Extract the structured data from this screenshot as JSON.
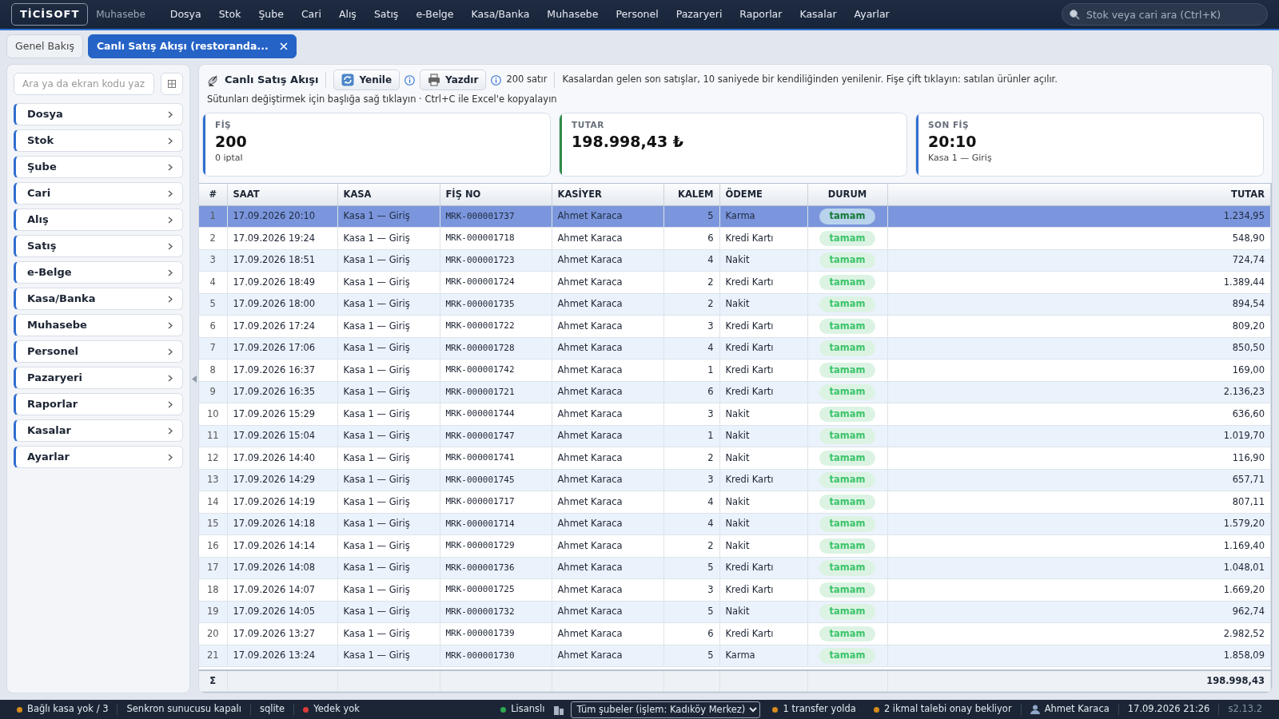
{
  "app": {
    "logo": "TİCİSOFT",
    "module": "Muhasebe"
  },
  "menu": [
    "Dosya",
    "Stok",
    "Şube",
    "Cari",
    "Alış",
    "Satış",
    "e-Belge",
    "Kasa/Banka",
    "Muhasebe",
    "Personel",
    "Pazaryeri",
    "Raporlar",
    "Kasalar",
    "Ayarlar"
  ],
  "global_search": {
    "placeholder": "Stok veya cari ara (Ctrl+K)"
  },
  "tabs": [
    {
      "label": "Genel Bakış",
      "selected": false,
      "closable": false
    },
    {
      "label": "Canlı Satış Akışı (restoranda...",
      "selected": true,
      "closable": true
    }
  ],
  "sidebar": {
    "search": {
      "placeholder": "Ara ya da ekran kodu yaz"
    },
    "items": [
      "Dosya",
      "Stok",
      "Şube",
      "Cari",
      "Alış",
      "Satış",
      "e-Belge",
      "Kasa/Banka",
      "Muhasebe",
      "Personel",
      "Pazaryeri",
      "Raporlar",
      "Kasalar",
      "Ayarlar"
    ]
  },
  "toolbar": {
    "title": "Canlı Satış Akışı",
    "refresh": "Yenile",
    "print": "Yazdır",
    "row_count": "200 satır",
    "description": "Kasalardan gelen son satışlar, 10 saniyede bir kendiliğinden yenilenir. Fişe çift tıklayın: satılan ürünler açılır.",
    "hint": "Sütunları değiştirmek için başlığa sağ tıklayın · Ctrl+C ile Excel'e kopyalayın"
  },
  "kpis": [
    {
      "label": "FİŞ",
      "value": "200",
      "sub": "0 iptal",
      "color": "#2f6fd0"
    },
    {
      "label": "TUTAR",
      "value": "198.998,43 ₺",
      "color": "#2e8b4a"
    },
    {
      "label": "SON FİŞ",
      "value": "20:10",
      "sub": "Kasa 1 — Giriş",
      "color": "#2f6fd0"
    }
  ],
  "table": {
    "columns": [
      "#",
      "SAAT",
      "KASA",
      "FİŞ NO",
      "KASİYER",
      "KALEM",
      "ÖDEME",
      "DURUM",
      "TUTAR"
    ],
    "rows": [
      {
        "cells": [
          "1",
          "17.09.2026 20:10",
          "Kasa 1 — Giriş",
          "MRK-000001737",
          "Ahmet Karaca",
          "5",
          "Karma",
          "tamam",
          "1.234,95"
        ],
        "selected": true
      },
      {
        "cells": [
          "2",
          "17.09.2026 19:24",
          "Kasa 1 — Giriş",
          "MRK-000001718",
          "Ahmet Karaca",
          "6",
          "Kredi Kartı",
          "tamam",
          "548,90"
        ],
        "selected": false
      },
      {
        "cells": [
          "3",
          "17.09.2026 18:51",
          "Kasa 1 — Giriş",
          "MRK-000001723",
          "Ahmet Karaca",
          "4",
          "Nakit",
          "tamam",
          "724,74"
        ],
        "selected": false
      },
      {
        "cells": [
          "4",
          "17.09.2026 18:49",
          "Kasa 1 — Giriş",
          "MRK-000001724",
          "Ahmet Karaca",
          "2",
          "Kredi Kartı",
          "tamam",
          "1.389,44"
        ],
        "selected": false
      },
      {
        "cells": [
          "5",
          "17.09.2026 18:00",
          "Kasa 1 — Giriş",
          "MRK-000001735",
          "Ahmet Karaca",
          "2",
          "Nakit",
          "tamam",
          "894,54"
        ],
        "selected": false
      },
      {
        "cells": [
          "6",
          "17.09.2026 17:24",
          "Kasa 1 — Giriş",
          "MRK-000001722",
          "Ahmet Karaca",
          "3",
          "Kredi Kartı",
          "tamam",
          "809,20"
        ],
        "selected": false
      },
      {
        "cells": [
          "7",
          "17.09.2026 17:06",
          "Kasa 1 — Giriş",
          "MRK-000001728",
          "Ahmet Karaca",
          "4",
          "Kredi Kartı",
          "tamam",
          "850,50"
        ],
        "selected": false
      },
      {
        "cells": [
          "8",
          "17.09.2026 16:37",
          "Kasa 1 — Giriş",
          "MRK-000001742",
          "Ahmet Karaca",
          "1",
          "Kredi Kartı",
          "tamam",
          "169,00"
        ],
        "selected": false
      },
      {
        "cells": [
          "9",
          "17.09.2026 16:35",
          "Kasa 1 — Giriş",
          "MRK-000001721",
          "Ahmet Karaca",
          "6",
          "Kredi Kartı",
          "tamam",
          "2.136,23"
        ],
        "selected": false
      },
      {
        "cells": [
          "10",
          "17.09.2026 15:29",
          "Kasa 1 — Giriş",
          "MRK-000001744",
          "Ahmet Karaca",
          "3",
          "Nakit",
          "tamam",
          "636,60"
        ],
        "selected": false
      },
      {
        "cells": [
          "11",
          "17.09.2026 15:04",
          "Kasa 1 — Giriş",
          "MRK-000001747",
          "Ahmet Karaca",
          "1",
          "Nakit",
          "tamam",
          "1.019,70"
        ],
        "selected": false
      },
      {
        "cells": [
          "12",
          "17.09.2026 14:40",
          "Kasa 1 — Giriş",
          "MRK-000001741",
          "Ahmet Karaca",
          "2",
          "Nakit",
          "tamam",
          "116,90"
        ],
        "selected": false
      },
      {
        "cells": [
          "13",
          "17.09.2026 14:29",
          "Kasa 1 — Giriş",
          "MRK-000001745",
          "Ahmet Karaca",
          "3",
          "Kredi Kartı",
          "tamam",
          "657,71"
        ],
        "selected": false
      },
      {
        "cells": [
          "14",
          "17.09.2026 14:19",
          "Kasa 1 — Giriş",
          "MRK-000001717",
          "Ahmet Karaca",
          "4",
          "Nakit",
          "tamam",
          "807,11"
        ],
        "selected": false
      },
      {
        "cells": [
          "15",
          "17.09.2026 14:18",
          "Kasa 1 — Giriş",
          "MRK-000001714",
          "Ahmet Karaca",
          "4",
          "Nakit",
          "tamam",
          "1.579,20"
        ],
        "selected": false
      },
      {
        "cells": [
          "16",
          "17.09.2026 14:14",
          "Kasa 1 — Giriş",
          "MRK-000001729",
          "Ahmet Karaca",
          "2",
          "Nakit",
          "tamam",
          "1.169,40"
        ],
        "selected": false
      },
      {
        "cells": [
          "17",
          "17.09.2026 14:08",
          "Kasa 1 — Giriş",
          "MRK-000001736",
          "Ahmet Karaca",
          "5",
          "Kredi Kartı",
          "tamam",
          "1.048,01"
        ],
        "selected": false
      },
      {
        "cells": [
          "18",
          "17.09.2026 14:07",
          "Kasa 1 — Giriş",
          "MRK-000001725",
          "Ahmet Karaca",
          "3",
          "Kredi Kartı",
          "tamam",
          "1.669,20"
        ],
        "selected": false
      },
      {
        "cells": [
          "19",
          "17.09.2026 14:05",
          "Kasa 1 — Giriş",
          "MRK-000001732",
          "Ahmet Karaca",
          "5",
          "Nakit",
          "tamam",
          "962,74"
        ],
        "selected": false
      },
      {
        "cells": [
          "20",
          "17.09.2026 13:27",
          "Kasa 1 — Giriş",
          "MRK-000001739",
          "Ahmet Karaca",
          "6",
          "Kredi Kartı",
          "tamam",
          "2.982,52"
        ],
        "selected": false
      },
      {
        "cells": [
          "21",
          "17.09.2026 13:24",
          "Kasa 1 — Giriş",
          "MRK-000001730",
          "Ahmet Karaca",
          "5",
          "Karma",
          "tamam",
          "1.858,09"
        ],
        "selected": false
      }
    ],
    "footer": {
      "sigma": "Σ",
      "total": "198.998,43"
    }
  },
  "status_bar": [
    {
      "kind": "dot",
      "text": "Bağlı kasa yok / 3",
      "color": "#d88a1c"
    },
    {
      "kind": "text",
      "text": "Senkron sunucusu kapalı"
    },
    {
      "kind": "text",
      "text": "sqlite"
    },
    {
      "kind": "dot",
      "text": "Yedek yok",
      "color": "#d93a3a"
    },
    {
      "kind": "spacer"
    },
    {
      "kind": "dot",
      "text": "Lisanslı",
      "color": "#2fa84f"
    },
    {
      "kind": "select",
      "text": "Tüm şubeler (işlem: Kadıköy Merkez)"
    },
    {
      "kind": "dot",
      "text": "1 transfer yolda",
      "color": "#d88a1c"
    },
    {
      "kind": "dot",
      "text": "2 ikmal talebi onay bekliyor",
      "color": "#d88a1c"
    },
    {
      "kind": "user",
      "text": "Ahmet Karaca"
    },
    {
      "kind": "text",
      "text": "17.09.2026 21:26"
    },
    {
      "kind": "muted",
      "text": "s2.13.2"
    }
  ]
}
